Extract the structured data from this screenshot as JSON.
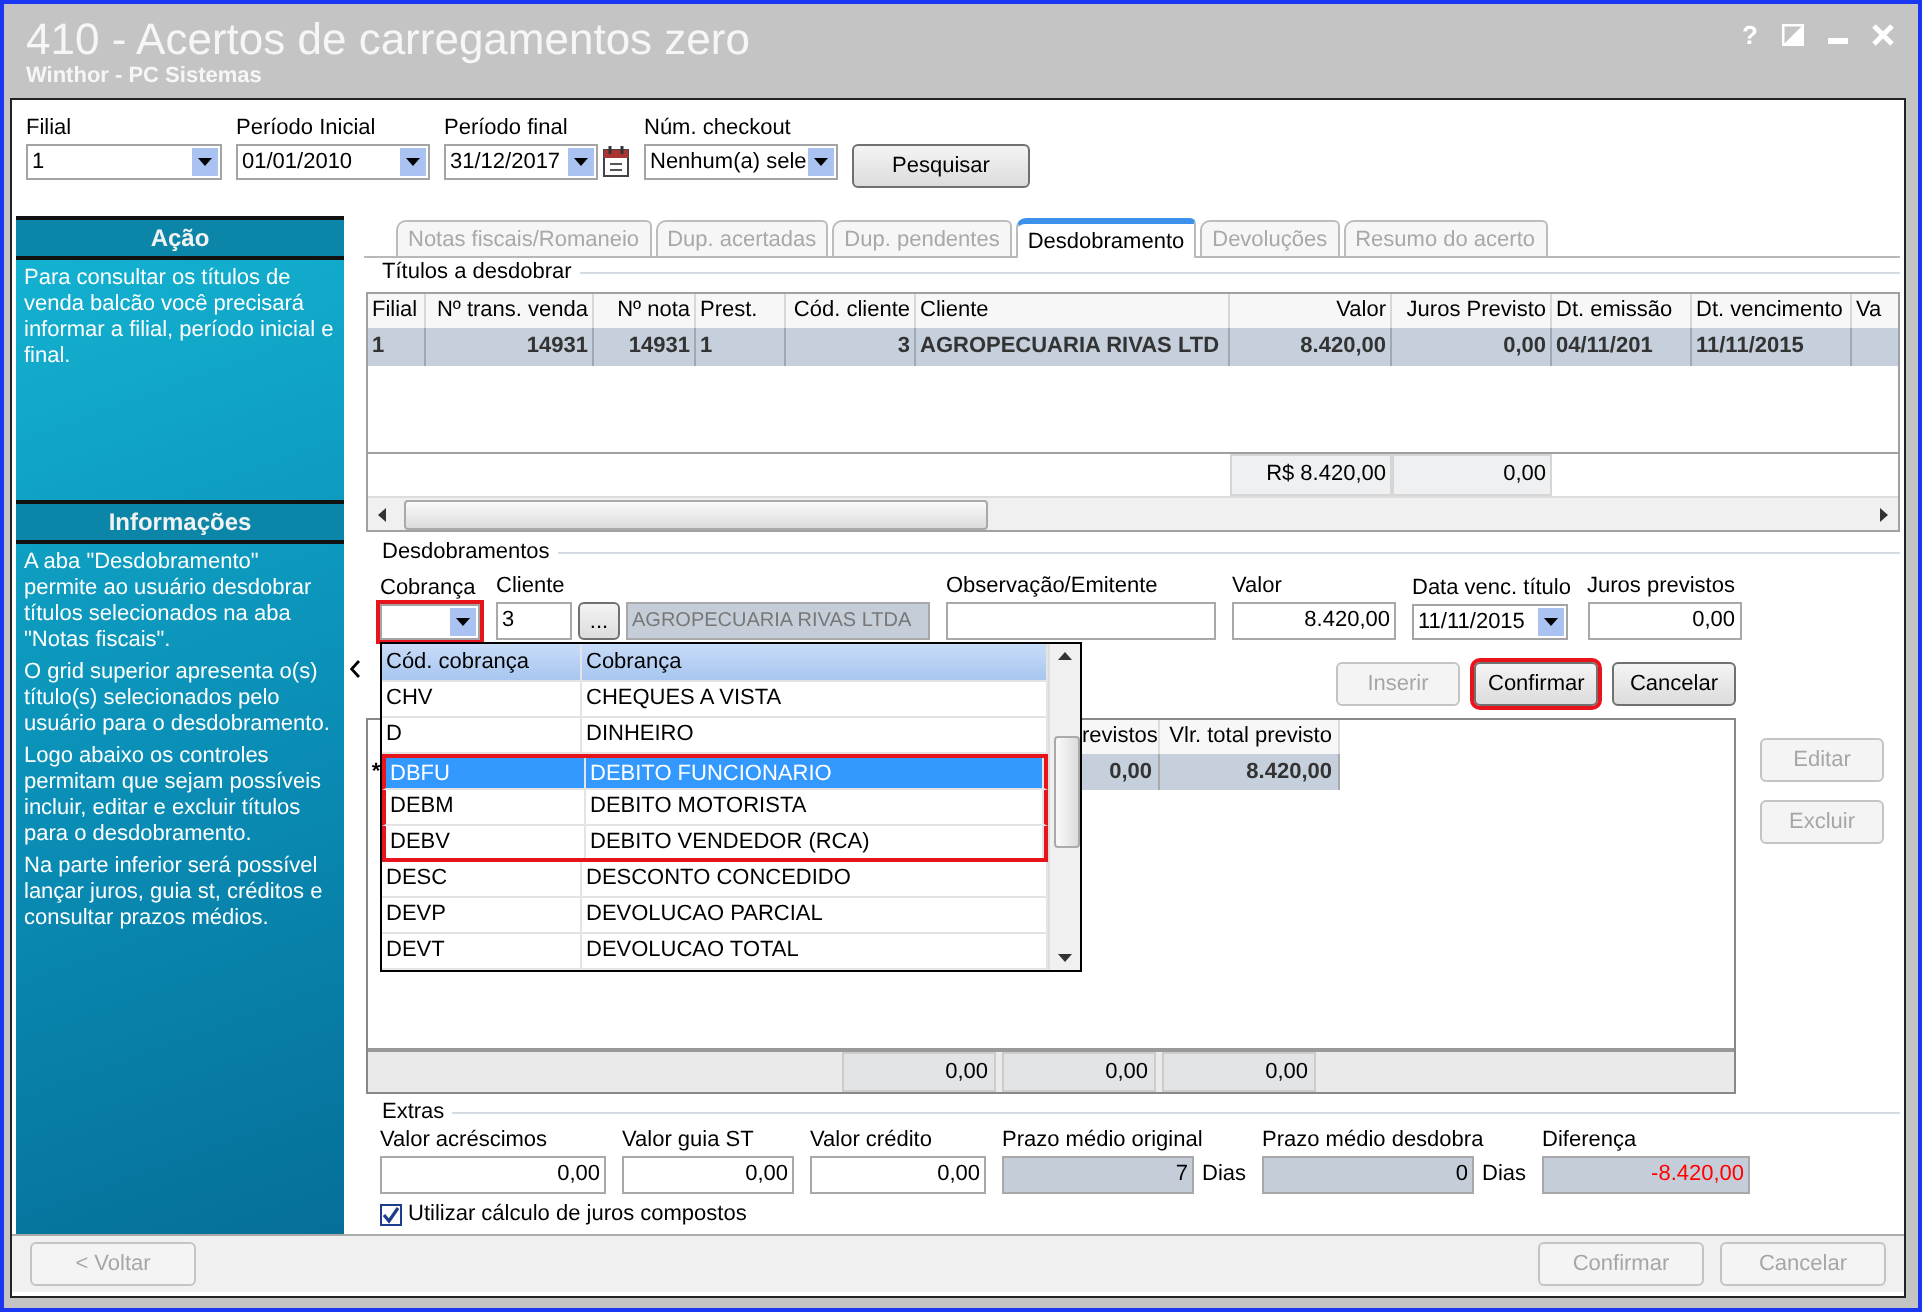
{
  "window": {
    "title": "410 - Acertos de carregamentos zero",
    "subtitle": "Winthor - PC Sistemas",
    "help": "?"
  },
  "filters": [
    {
      "label": "Filial",
      "value": "1",
      "kind": "combo"
    },
    {
      "label": "Período Inicial",
      "value": "01/01/2010",
      "kind": "combo"
    },
    {
      "label": "Período final",
      "value": "31/12/2017",
      "kind": "date"
    },
    {
      "label": "Núm. checkout",
      "value": "Nenhum(a) sele",
      "kind": "combo"
    }
  ],
  "search_button": {
    "label": "Pesquisar"
  },
  "sidebar": [
    {
      "title": "Ação",
      "paragraphs": [
        "Para consultar os títulos de venda balcão você precisará informar a filial, período inicial e final."
      ]
    },
    {
      "title": "Informações",
      "paragraphs": [
        "A aba \"Desdobramento\" permite ao usuário desdobrar títulos selecionados na aba \"Notas fiscais\".",
        "O grid superior apresenta o(s) título(s) selecionados pelo usuário para o desdobramento.",
        "Logo abaixo os controles permitam que sejam possíveis incluir, editar e excluir títulos para o desdobramento.",
        "Na parte inferior será possível lançar juros, guia st, créditos e consultar prazos médios."
      ]
    }
  ],
  "tabs": [
    {
      "label": "Notas fiscais/Romaneio",
      "selected": false
    },
    {
      "label": "Dup. acertadas",
      "selected": false
    },
    {
      "label": "Dup. pendentes",
      "selected": false
    },
    {
      "label": "Desdobramento",
      "selected": true
    },
    {
      "label": "Devoluções",
      "selected": false
    },
    {
      "label": "Resumo do acerto",
      "selected": false
    }
  ],
  "titulos": {
    "title": "Títulos a desdobrar",
    "columns": [
      "Filial",
      "Nº trans. venda",
      "Nº nota",
      "Prest.",
      "Cód. cliente",
      "Cliente",
      "Valor",
      "Juros Previsto",
      "Dt. emissão",
      "Dt. vencimento",
      "Va"
    ],
    "rows": [
      {
        "selected": true,
        "cells": [
          "1",
          "14931",
          "14931",
          "1",
          "3",
          "AGROPECUARIA RIVAS LTD",
          "8.420,00",
          "0,00",
          "04/11/201",
          "11/11/2015"
        ]
      }
    ],
    "totals": [
      "R$ 8.420,00",
      "0,00"
    ]
  },
  "desdobramentos": {
    "title": "Desdobramentos",
    "cobranca": {
      "label": "Cobrança",
      "highlighted": true
    },
    "cliente": {
      "label": "Cliente",
      "value": "3",
      "lookup": "...",
      "name": "AGROPECUARIA RIVAS LTDA"
    },
    "fields": [
      {
        "label": "Observação/Emitente",
        "kind": "text"
      },
      {
        "label": "Valor",
        "value": "8.420,00",
        "kind": "number"
      },
      {
        "label": "Data venc. título",
        "value": "11/11/2015",
        "kind": "combo"
      },
      {
        "label": "Juros previstos",
        "value": "0,00",
        "kind": "number"
      }
    ],
    "buttons": [
      {
        "label": "Inserir",
        "disabled": true,
        "highlighted": false
      },
      {
        "label": "Confirmar",
        "disabled": false,
        "highlighted": true
      },
      {
        "label": "Cancelar",
        "disabled": false,
        "highlighted": false
      }
    ],
    "grid": {
      "columns": [
        "revistos",
        "Vlr. total previsto"
      ],
      "rows": [
        {
          "marker": "*",
          "cells": [
            "0,00",
            "8.420,00"
          ]
        }
      ],
      "totals": [
        "0,00",
        "0,00",
        "0,00"
      ]
    },
    "side_buttons": [
      {
        "label": "Editar",
        "disabled": true
      },
      {
        "label": "Excluir",
        "disabled": true
      }
    ]
  },
  "dropdown": {
    "columns": [
      "Cód. cobrança",
      "Cobrança"
    ],
    "rows": [
      {
        "code": "CHV",
        "name": "CHEQUES A VISTA",
        "selected": false,
        "highlighted": false
      },
      {
        "code": "D",
        "name": "DINHEIRO",
        "selected": false,
        "highlighted": false
      },
      {
        "code": "DBFU",
        "name": "DEBITO FUNCIONARIO",
        "selected": true,
        "highlighted": true
      },
      {
        "code": "DEBM",
        "name": "DEBITO MOTORISTA",
        "selected": false,
        "highlighted": true
      },
      {
        "code": "DEBV",
        "name": "DEBITO VENDEDOR (RCA)",
        "selected": false,
        "highlighted": true
      },
      {
        "code": "DESC",
        "name": "DESCONTO CONCEDIDO",
        "selected": false,
        "highlighted": false
      },
      {
        "code": "DEVP",
        "name": "DEVOLUCAO PARCIAL",
        "selected": false,
        "highlighted": false
      },
      {
        "code": "DEVT",
        "name": "DEVOLUCAO TOTAL",
        "selected": false,
        "highlighted": false
      }
    ]
  },
  "extras": {
    "title": "Extras",
    "fields": [
      {
        "label": "Valor acréscimos",
        "value": "0,00",
        "readonly": false,
        "color": "#000000"
      },
      {
        "label": "Valor guia ST",
        "value": "0,00",
        "readonly": false,
        "color": "#000000"
      },
      {
        "label": "Valor crédito",
        "value": "0,00",
        "readonly": false,
        "color": "#000000"
      },
      {
        "label": "Prazo médio original",
        "value": "7",
        "readonly": true,
        "unit": "Dias",
        "color": "#000000"
      },
      {
        "label": "Prazo médio desdobra",
        "value": "0",
        "readonly": true,
        "unit": "Dias",
        "color": "#000000"
      },
      {
        "label": "Diferença",
        "value": "-8.420,00",
        "readonly": true,
        "color": "#ff0000"
      }
    ],
    "checkbox": {
      "label": "Utilizar cálculo de juros compostos",
      "checked": true
    }
  },
  "footer": {
    "back": {
      "label": "< Voltar",
      "disabled": true
    },
    "buttons": [
      {
        "label": "Confirmar",
        "disabled": true
      },
      {
        "label": "Cancelar",
        "disabled": true
      }
    ]
  }
}
